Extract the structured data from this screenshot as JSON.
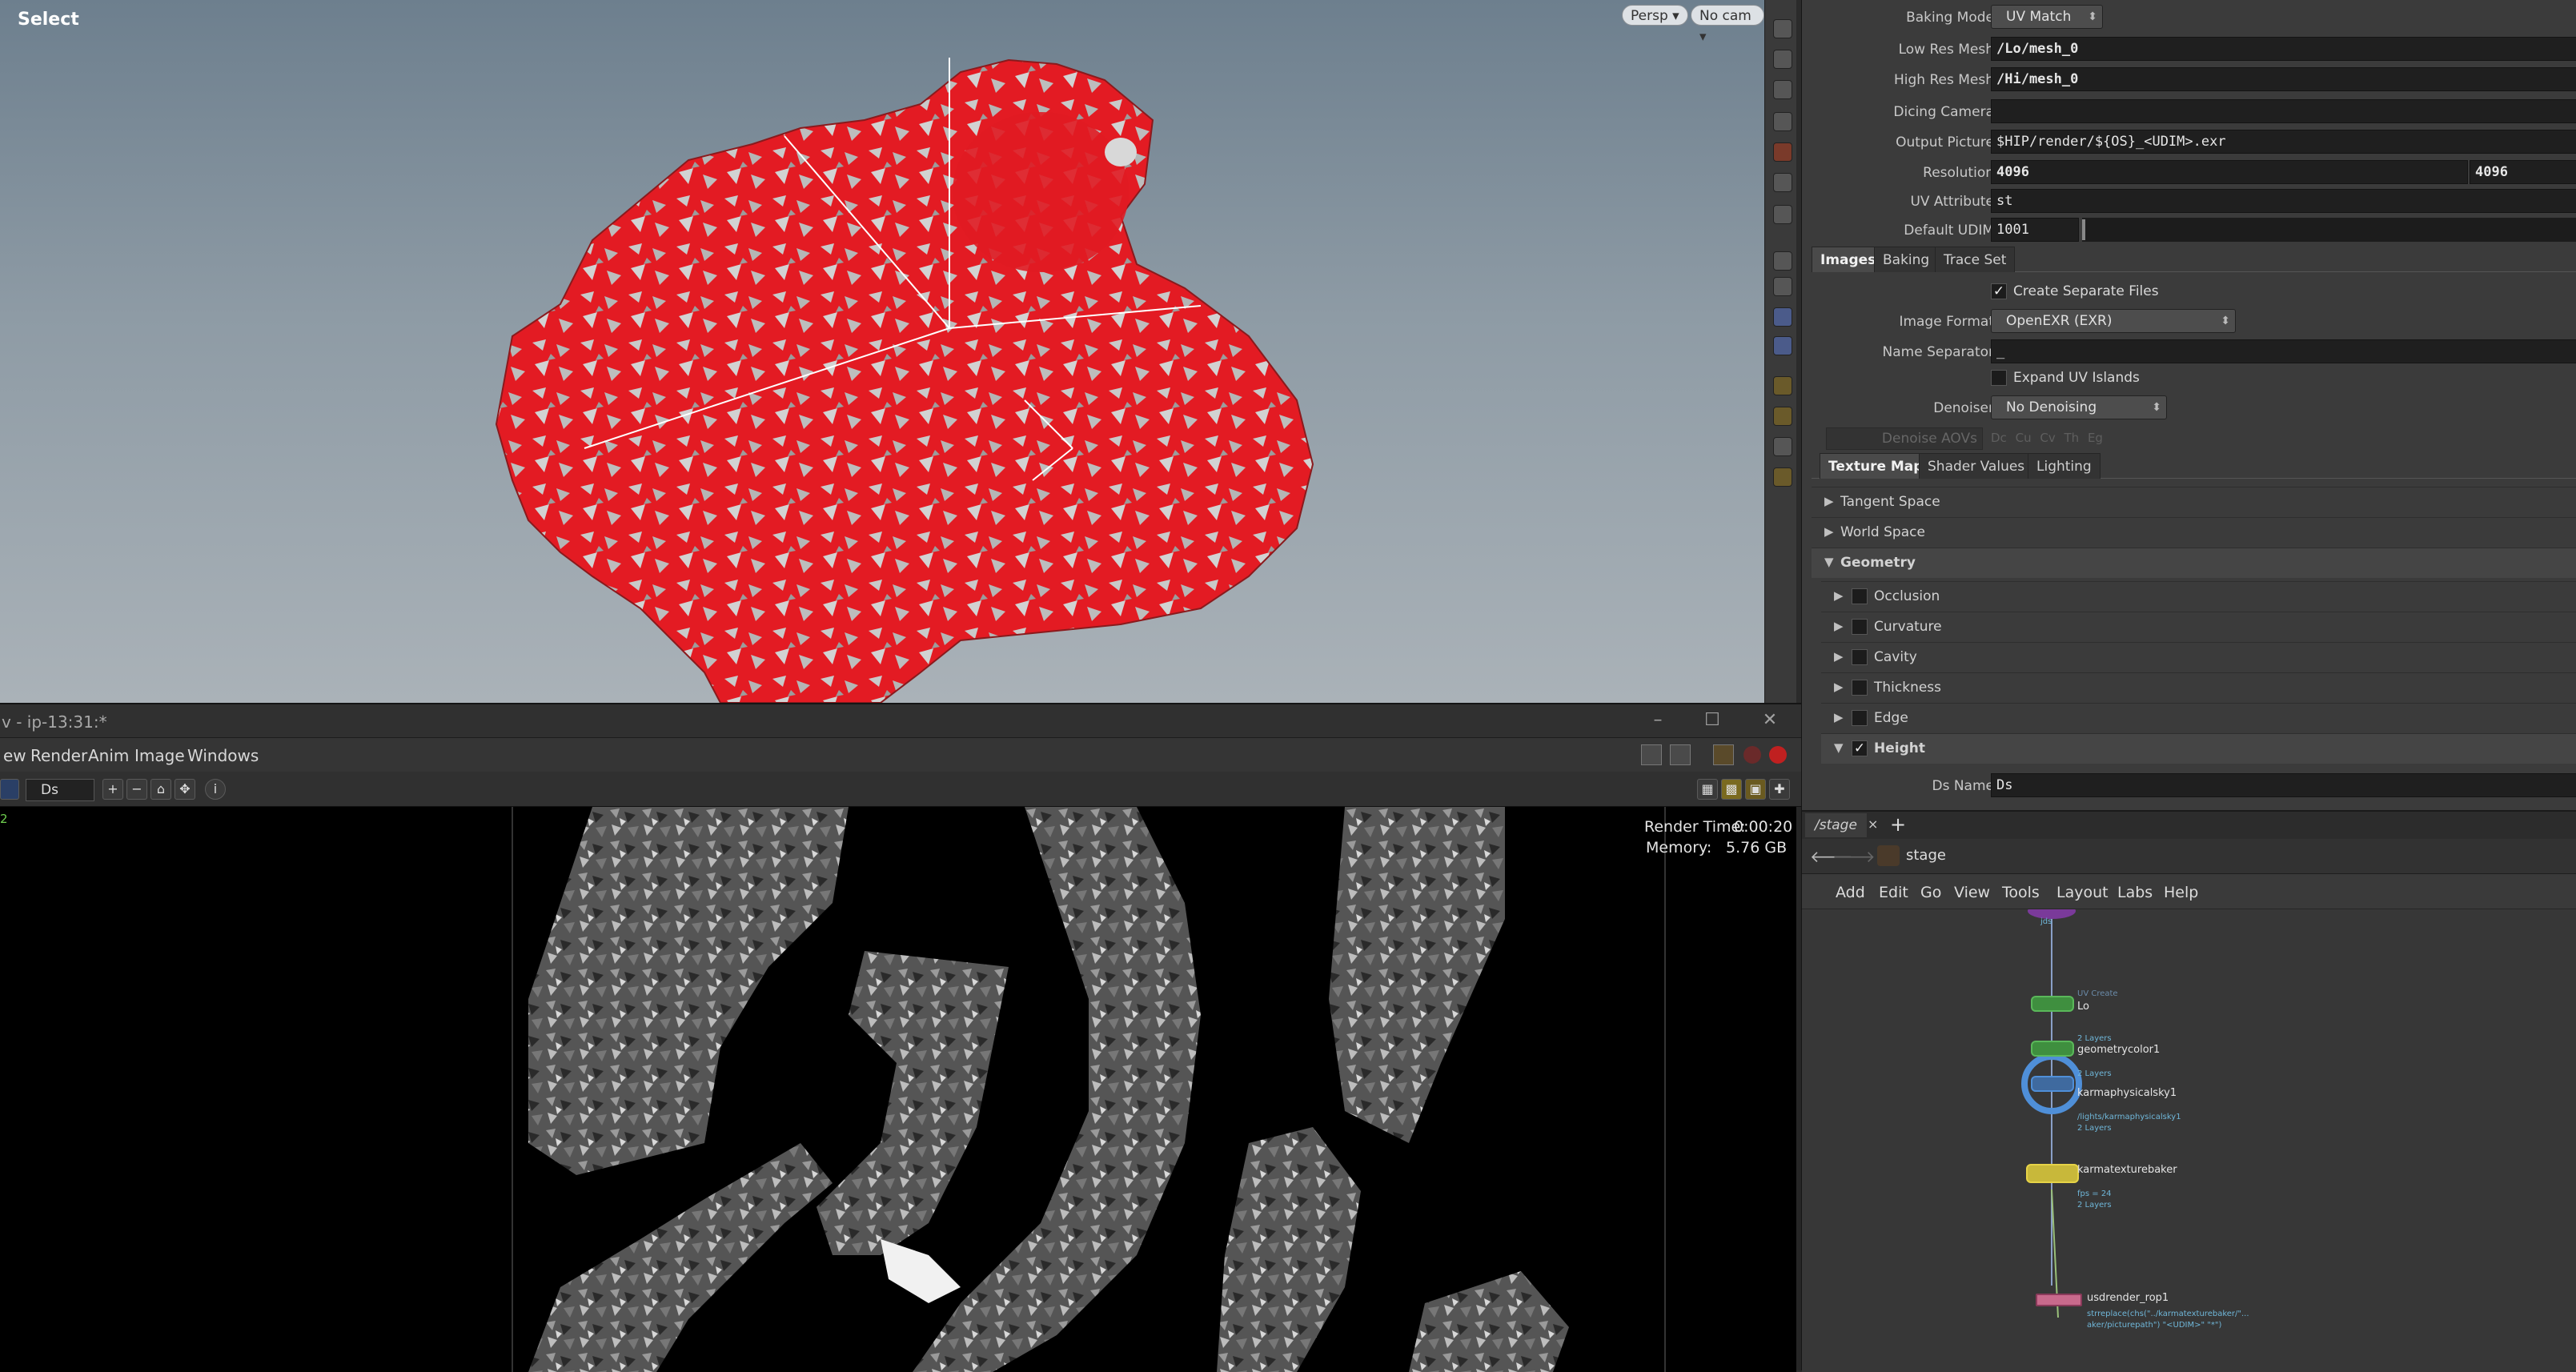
{
  "viewport": {
    "mode": "Select",
    "buttons": [
      "Persp ▾",
      "No cam ▾"
    ]
  },
  "render_view": {
    "window_title": "v - ip-13:31:*",
    "menu": [
      "ew",
      "Render",
      "Anim",
      "Image",
      "Windows"
    ],
    "aov_select": "Ds",
    "render_time_label": "Render Time:",
    "render_time_value": "0:00:20",
    "memory_label": "Memory:",
    "memory_value": "5.76 GB",
    "corner_number": "2"
  },
  "params": {
    "baking_mode": {
      "label": "Baking Mode",
      "value": "UV Match"
    },
    "low_res_mesh": {
      "label": "Low Res Mesh",
      "value": "/Lo/mesh_0"
    },
    "high_res_mesh": {
      "label": "High Res Mesh",
      "value": "/Hi/mesh_0"
    },
    "dicing_camera": {
      "label": "Dicing Camera",
      "value": ""
    },
    "output_picture": {
      "label": "Output Picture",
      "value": "$HIP/render/${OS}_<UDIM>.exr"
    },
    "resolution": {
      "label": "Resolution",
      "x": "4096",
      "y": "4096"
    },
    "uv_attribute": {
      "label": "UV Attribute",
      "value": "st"
    },
    "default_udim": {
      "label": "Default UDIM",
      "value": "1001"
    },
    "tabs1": [
      "Images",
      "Baking",
      "Trace Set"
    ],
    "create_separate_files": "Create Separate Files",
    "image_format": {
      "label": "Image Format",
      "value": "OpenEXR (EXR)"
    },
    "name_separator": {
      "label": "Name Separator",
      "value": "_"
    },
    "expand_uv_islands": "Expand UV Islands",
    "denoiser": {
      "label": "Denoiser",
      "value": "No Denoising"
    },
    "denoise_aovs": {
      "label": "Denoise AOVs",
      "options": [
        "Dc",
        "Cu",
        "Cv",
        "Th",
        "Eg"
      ]
    },
    "tabs2": [
      "Texture Maps",
      "Shader Values",
      "Lighting"
    ],
    "folders": [
      "Tangent Space",
      "World Space",
      "Geometry"
    ],
    "maps": [
      "Occlusion",
      "Curvature",
      "Cavity",
      "Thickness",
      "Edge",
      "Height"
    ],
    "ds_name": {
      "label": "Ds Name",
      "value": "Ds"
    }
  },
  "network": {
    "tab": "/stage",
    "path": "stage",
    "menu": [
      "Add",
      "Edit",
      "Go",
      "View",
      "Tools",
      "Layout",
      "Labs",
      "Help"
    ],
    "nodes": [
      {
        "name": "Lo",
        "sub": "2 Layers",
        "pre": "UV Create"
      },
      {
        "name": "geometrycolor1",
        "sub": "2 Layers"
      },
      {
        "name": "karmaphysicalsky1",
        "sub": "/lights/karmaphysicalsky1",
        "sub2": "2 Layers"
      },
      {
        "name": "karmatexturebaker",
        "sub": "fps = 24",
        "sub2": "2 Layers"
      },
      {
        "name": "usdrender_rop1",
        "sub": "strreplace(chs(\"../karmatexturebaker/\"...",
        "sub2": "aker/picturepath\") \"<UDIM>\" \"*\")"
      }
    ],
    "top_node_label": "jds"
  },
  "colors": {
    "accent_blue": "#4f8fd8",
    "node_green": "#3f8f3f",
    "node_selected": "#e6d347",
    "rop_pink": "#c86a8c"
  }
}
